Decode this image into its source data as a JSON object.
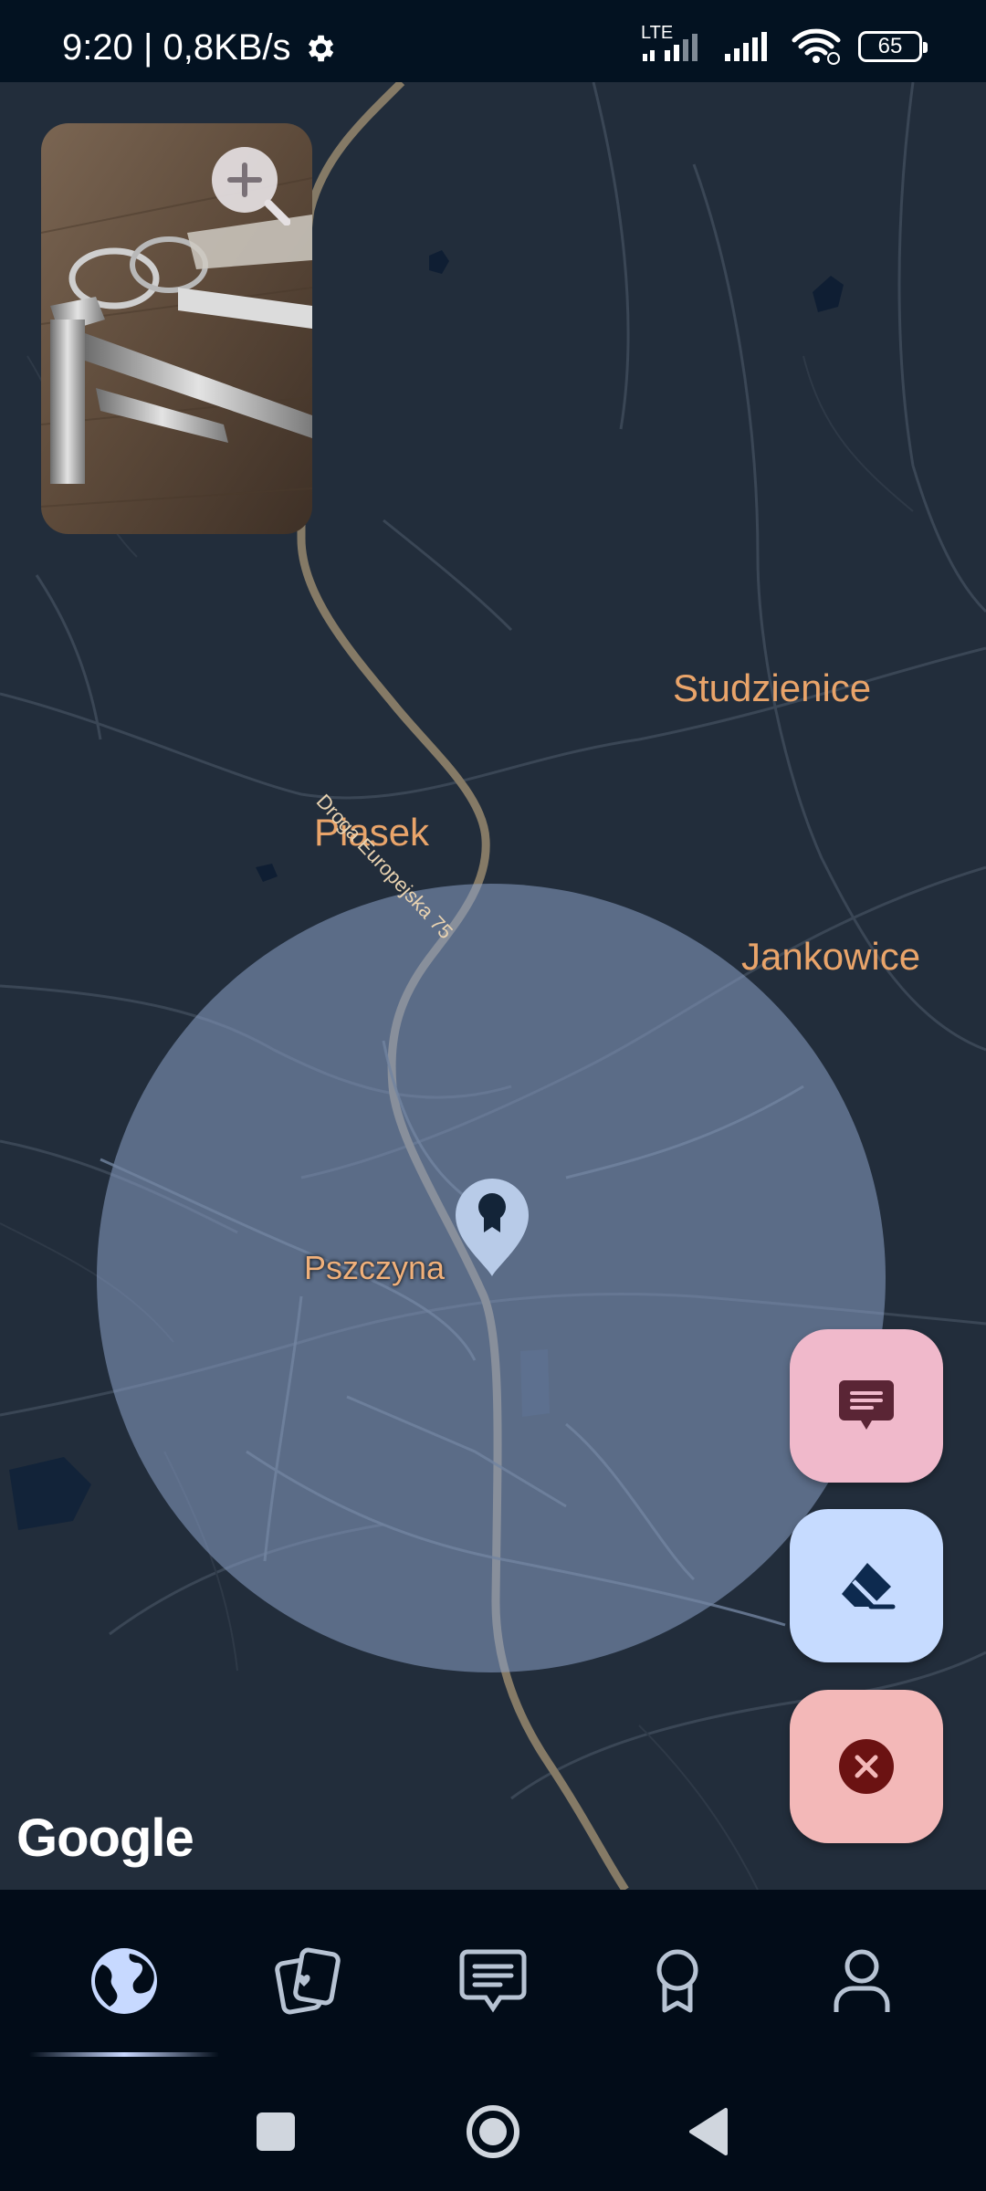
{
  "status_bar": {
    "time_speed": "9:20 | 0,8KB/s",
    "network_label": "LTE",
    "battery": "65"
  },
  "map": {
    "places": {
      "studzienice": "Studzienice",
      "piasek": "Piasek",
      "jankowice": "Jankowice",
      "pszczyna": "Pszczyna"
    },
    "road_label": "Droga Europejska 75",
    "attribution": "Google"
  },
  "fabs": [
    "message",
    "eraser",
    "close"
  ],
  "bottom_nav": {
    "items": [
      "globe",
      "cards",
      "chat",
      "badge",
      "profile"
    ],
    "selected": "globe"
  },
  "colors": {
    "map_bg": "#222d3b",
    "radius_fill": "#8aa0c6",
    "fab_message": "#f0b9cb",
    "fab_eraser": "#c6dbff",
    "fab_close": "#f3b8b8",
    "accent": "#c9d8ff"
  }
}
